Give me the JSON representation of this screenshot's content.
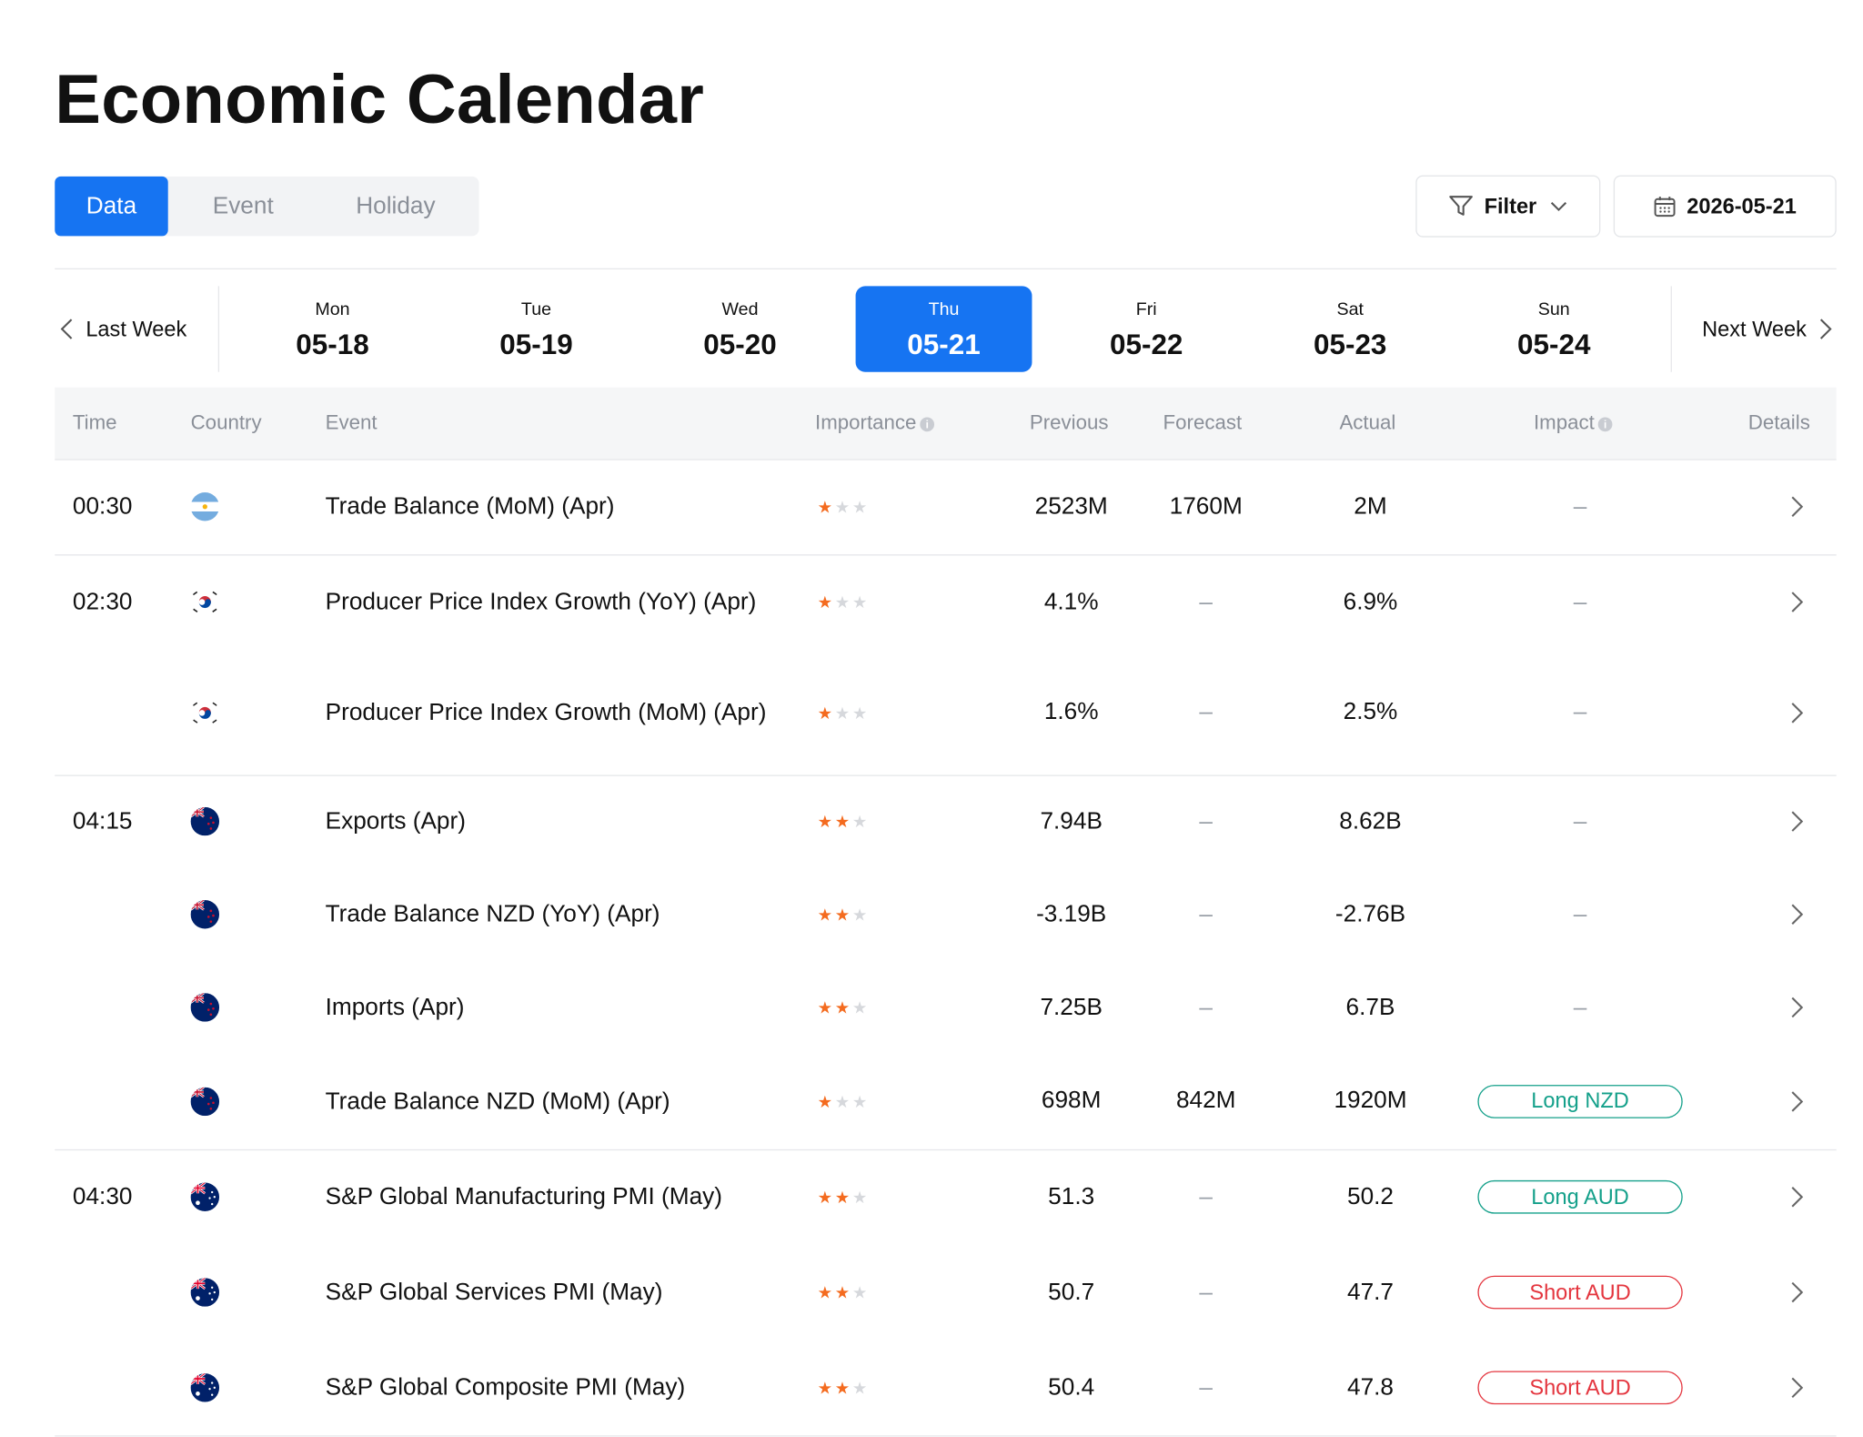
{
  "page": {
    "title": "Economic Calendar"
  },
  "tabs": [
    "Data",
    "Event",
    "Holiday"
  ],
  "toolbar": {
    "filter_label": "Filter",
    "date_label": "2026-05-21"
  },
  "week_nav": {
    "prev_label": "Last Week",
    "next_label": "Next Week",
    "days": [
      {
        "name": "Mon",
        "date": "05-18"
      },
      {
        "name": "Tue",
        "date": "05-19"
      },
      {
        "name": "Wed",
        "date": "05-20"
      },
      {
        "name": "Thu",
        "date": "05-21",
        "active": true
      },
      {
        "name": "Fri",
        "date": "05-22"
      },
      {
        "name": "Sat",
        "date": "05-23"
      },
      {
        "name": "Sun",
        "date": "05-24"
      }
    ]
  },
  "table": {
    "headers": {
      "time": "Time",
      "country": "Country",
      "event": "Event",
      "importance": "Importance",
      "previous": "Previous",
      "forecast": "Forecast",
      "actual": "Actual",
      "impact": "Impact",
      "details": "Details"
    },
    "rows": [
      {
        "time": "00:30",
        "flag": "argentina-flag-icon",
        "event": "Trade Balance (MoM) (Apr)",
        "stars": 1,
        "previous": "2523M",
        "forecast": "1760M",
        "actual": "2M",
        "impact": "–",
        "impact_type": "none"
      },
      {
        "time": "02:30",
        "flag": "south-korea-flag-icon",
        "event": "Producer Price Index Growth (YoY) (Apr)",
        "stars": 1,
        "previous": "4.1%",
        "forecast": "–",
        "actual": "6.9%",
        "impact": "–",
        "impact_type": "none"
      },
      {
        "time": "",
        "flag": "south-korea-flag-icon",
        "event": "Producer Price Index Growth (MoM) (Apr)",
        "stars": 1,
        "previous": "1.6%",
        "forecast": "–",
        "actual": "2.5%",
        "impact": "–",
        "impact_type": "none"
      },
      {
        "time": "04:15",
        "flag": "new-zealand-flag-icon",
        "event": "Exports (Apr)",
        "stars": 2,
        "previous": "7.94B",
        "forecast": "–",
        "actual": "8.62B",
        "impact": "–",
        "impact_type": "none"
      },
      {
        "time": "",
        "flag": "new-zealand-flag-icon",
        "event": "Trade Balance NZD (YoY) (Apr)",
        "stars": 2,
        "previous": "-3.19B",
        "forecast": "–",
        "actual": "-2.76B",
        "impact": "–",
        "impact_type": "none"
      },
      {
        "time": "",
        "flag": "new-zealand-flag-icon",
        "event": "Imports (Apr)",
        "stars": 2,
        "previous": "7.25B",
        "forecast": "–",
        "actual": "6.7B",
        "impact": "–",
        "impact_type": "none"
      },
      {
        "time": "",
        "flag": "new-zealand-flag-icon",
        "event": "Trade Balance NZD (MoM) (Apr)",
        "stars": 1,
        "previous": "698M",
        "forecast": "842M",
        "actual": "1920M",
        "impact": "Long NZD",
        "impact_type": "long"
      },
      {
        "time": "04:30",
        "flag": "australia-flag-icon",
        "event": "S&P Global Manufacturing PMI (May)",
        "stars": 2,
        "previous": "51.3",
        "forecast": "–",
        "actual": "50.2",
        "impact": "Long AUD",
        "impact_type": "long"
      },
      {
        "time": "",
        "flag": "australia-flag-icon",
        "event": "S&P Global Services PMI (May)",
        "stars": 2,
        "previous": "50.7",
        "forecast": "–",
        "actual": "47.7",
        "impact": "Short AUD",
        "impact_type": "short"
      },
      {
        "time": "",
        "flag": "australia-flag-icon",
        "event": "S&P Global Composite PMI (May)",
        "stars": 2,
        "previous": "50.4",
        "forecast": "–",
        "actual": "47.8",
        "impact": "Short AUD",
        "impact_type": "short"
      }
    ]
  },
  "colors": {
    "accent": "#1674f2",
    "star": "#f46b1f",
    "long": "#14a08a",
    "short": "#e4363f"
  }
}
